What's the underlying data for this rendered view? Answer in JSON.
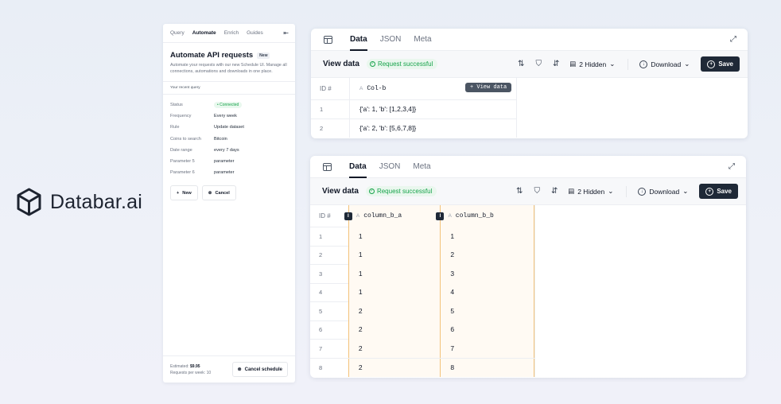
{
  "brand": {
    "name": "Databar.ai"
  },
  "panel": {
    "tabs": [
      "Query",
      "Automate",
      "Enrich",
      "Guides"
    ],
    "active_tab": "Automate",
    "title": "Automate API requests",
    "badge": "New",
    "description": "Automate your requests with our new Schedule UI. Manage all connections, automations and downloads in one place.",
    "section_label": "Your recent query",
    "fields": [
      {
        "key": "Status",
        "value": "Connected"
      },
      {
        "key": "Frequency",
        "value": "Every week"
      },
      {
        "key": "Rule",
        "value": "Update dataset"
      },
      {
        "key": "Coins to search",
        "value": "Bitcoin"
      },
      {
        "key": "Date range",
        "value": "every 7 days"
      },
      {
        "key": "Parameter 5",
        "value": "parameter"
      },
      {
        "key": "Parameter 6",
        "value": "parameter"
      }
    ],
    "new_label": "New",
    "cancel_label": "Cancel",
    "estimated_label": "Estimated:",
    "estimated_value": "$9.95",
    "requests_label": "Requests per week:",
    "requests_value": "10",
    "cancel_schedule_label": "Cancel schedule"
  },
  "card_tabs": [
    "Data",
    "JSON",
    "Meta"
  ],
  "toolbar": {
    "view_data": "View data",
    "status": "Request successful",
    "hidden": "2 Hidden",
    "download": "Download",
    "save": "Save"
  },
  "table1": {
    "id_header": "ID",
    "column": "Col-b",
    "view_button": "+ View data",
    "rows": [
      {
        "id": "1",
        "value": "{'a': 1, 'b': [1,2,3,4]}"
      },
      {
        "id": "2",
        "value": "{'a': 2, 'b': [5,6,7,8]}"
      }
    ]
  },
  "table2": {
    "id_header": "ID",
    "columns": [
      "column_b_a",
      "column_b_b"
    ],
    "rows": [
      {
        "id": "1",
        "a": "1",
        "b": "1"
      },
      {
        "id": "2",
        "a": "1",
        "b": "2"
      },
      {
        "id": "3",
        "a": "1",
        "b": "3"
      },
      {
        "id": "4",
        "a": "1",
        "b": "4"
      },
      {
        "id": "5",
        "a": "2",
        "b": "5"
      },
      {
        "id": "6",
        "a": "2",
        "b": "6"
      },
      {
        "id": "7",
        "a": "2",
        "b": "7"
      },
      {
        "id": "8",
        "a": "2",
        "b": "8"
      }
    ]
  }
}
